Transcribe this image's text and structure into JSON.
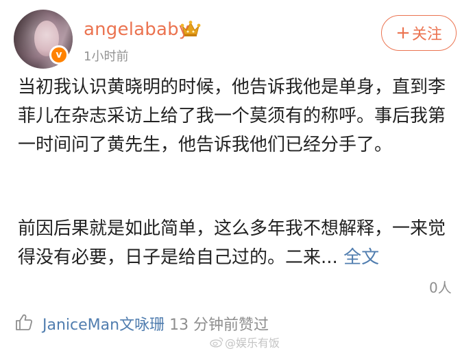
{
  "post": {
    "username": "angelababy",
    "timestamp": "1小时前",
    "follow_label": "关注",
    "follow_plus": "+",
    "verified_badge": "v",
    "paragraph1": "当初我认识黄晓明的时候，他告诉我他是单身，直到李菲儿在杂志采访上给了我一个莫须有的称呼。事后我第一时间问了黄先生，他告诉我他们已经分手了。",
    "paragraph2_text": "前因后果就是如此简单，这么多年我不想解释，一来觉得没有必要，日子是给自己过的。二来... ",
    "fulltext_link": "全文",
    "like_count": "0人"
  },
  "liked_by": {
    "liker": "JaniceMan文咏珊",
    "suffix": " 13 分钟前赞过"
  },
  "watermark": {
    "text": "@娱乐有饭"
  },
  "colors": {
    "accent": "#eb7350",
    "link": "#507daf",
    "muted": "#939393",
    "badge": "#ff8200"
  },
  "icons": [
    "crown-icon",
    "verified-badge-icon",
    "thumbs-up-icon",
    "weibo-logo-icon",
    "plus-icon"
  ]
}
